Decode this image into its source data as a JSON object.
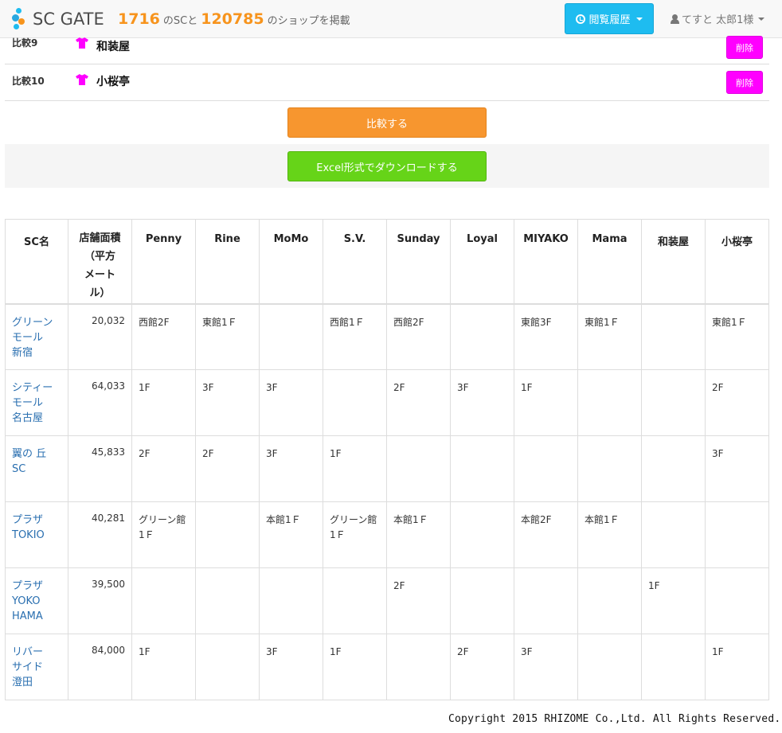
{
  "header": {
    "logo_text": "SC GATE",
    "sc_count": "1716",
    "sc_text": "のSCと",
    "shop_count": "120785",
    "shop_text": "のショップを掲載",
    "history_label": "閲覧履歴",
    "user_label": "てすと 太郎1様",
    "accent_color": "#1ebcf0",
    "count_color": "#f7941d"
  },
  "compare": {
    "rows": [
      {
        "label": "比較9",
        "name": "和装屋",
        "delete_label": "削除"
      },
      {
        "label": "比較10",
        "name": "小桜亭",
        "delete_label": "削除"
      }
    ],
    "compare_button": "比較する",
    "excel_button": "Excel形式でダウンロードする"
  },
  "table": {
    "headers": {
      "sc_name": "SC名",
      "area": "店舗面積\n（平方\nメート\nル）",
      "shops": [
        "Penny",
        "Rine",
        "MoMo",
        "S.V.",
        "Sunday",
        "Loyal",
        "MIYAKO",
        "Mama",
        "和装屋",
        "小桜亭"
      ]
    },
    "rows": [
      {
        "sc": "グリーン\nモール\n新宿",
        "area": "20,032",
        "cells": [
          "西館2F",
          "東館1Ｆ",
          "",
          "西館1Ｆ",
          "西館2F",
          "",
          "東館3F",
          "東館1Ｆ",
          "",
          "東館1Ｆ"
        ]
      },
      {
        "sc": "シティー\nモール\n名古屋",
        "area": "64,033",
        "cells": [
          "1F",
          "3F",
          "3F",
          "",
          "2F",
          "3F",
          "1F",
          "",
          "",
          "2F"
        ]
      },
      {
        "sc": "翼の 丘\nSC",
        "area": "45,833",
        "cells": [
          "2F",
          "2F",
          "3F",
          "1F",
          "",
          "",
          "",
          "",
          "",
          "3F"
        ]
      },
      {
        "sc": "プラザ\nTOKIO",
        "area": "40,281",
        "cells": [
          "グリーン館\n1Ｆ",
          "",
          "本館1Ｆ",
          "グリーン館\n1Ｆ",
          "本館1Ｆ",
          "",
          "本館2F",
          "本館1Ｆ",
          "",
          ""
        ]
      },
      {
        "sc": "プラザ\nYOKO\nHAMA",
        "area": "39,500",
        "cells": [
          "",
          "",
          "",
          "",
          "2F",
          "",
          "",
          "",
          "1F",
          ""
        ]
      },
      {
        "sc": "リバー\nサイド\n澄田",
        "area": "84,000",
        "cells": [
          "1F",
          "",
          "3F",
          "1F",
          "",
          "2F",
          "3F",
          "",
          "",
          "1F"
        ]
      }
    ]
  },
  "footer": {
    "copyright": "Copyright 2015 RHIZOME Co.,Ltd. All Rights Reserved."
  },
  "colors": {
    "delete": "#ff00ff",
    "compare": "#f7962f",
    "excel": "#66d418",
    "link": "#2a6fb0",
    "shirt": "#ff00ff"
  }
}
